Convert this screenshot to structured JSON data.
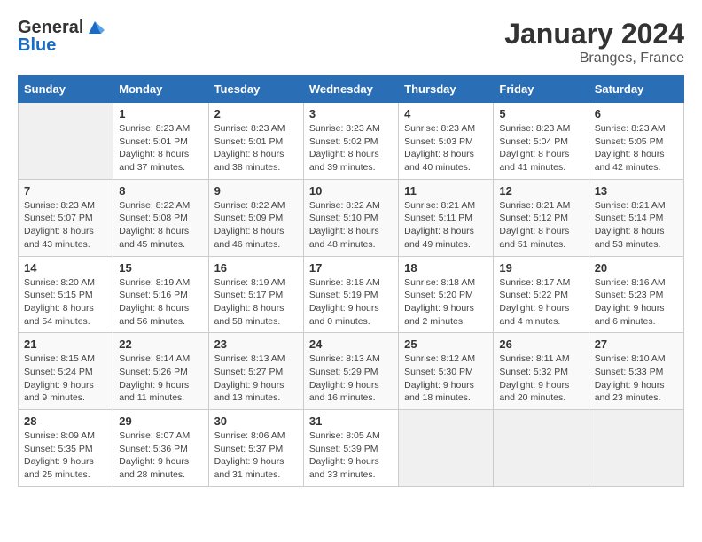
{
  "logo": {
    "line1": "General",
    "line2": "Blue"
  },
  "title": "January 2024",
  "subtitle": "Branges, France",
  "days_of_week": [
    "Sunday",
    "Monday",
    "Tuesday",
    "Wednesday",
    "Thursday",
    "Friday",
    "Saturday"
  ],
  "weeks": [
    [
      {
        "day": "",
        "info": ""
      },
      {
        "day": "1",
        "info": "Sunrise: 8:23 AM\nSunset: 5:01 PM\nDaylight: 8 hours\nand 37 minutes."
      },
      {
        "day": "2",
        "info": "Sunrise: 8:23 AM\nSunset: 5:01 PM\nDaylight: 8 hours\nand 38 minutes."
      },
      {
        "day": "3",
        "info": "Sunrise: 8:23 AM\nSunset: 5:02 PM\nDaylight: 8 hours\nand 39 minutes."
      },
      {
        "day": "4",
        "info": "Sunrise: 8:23 AM\nSunset: 5:03 PM\nDaylight: 8 hours\nand 40 minutes."
      },
      {
        "day": "5",
        "info": "Sunrise: 8:23 AM\nSunset: 5:04 PM\nDaylight: 8 hours\nand 41 minutes."
      },
      {
        "day": "6",
        "info": "Sunrise: 8:23 AM\nSunset: 5:05 PM\nDaylight: 8 hours\nand 42 minutes."
      }
    ],
    [
      {
        "day": "7",
        "info": "Sunrise: 8:23 AM\nSunset: 5:07 PM\nDaylight: 8 hours\nand 43 minutes."
      },
      {
        "day": "8",
        "info": "Sunrise: 8:22 AM\nSunset: 5:08 PM\nDaylight: 8 hours\nand 45 minutes."
      },
      {
        "day": "9",
        "info": "Sunrise: 8:22 AM\nSunset: 5:09 PM\nDaylight: 8 hours\nand 46 minutes."
      },
      {
        "day": "10",
        "info": "Sunrise: 8:22 AM\nSunset: 5:10 PM\nDaylight: 8 hours\nand 48 minutes."
      },
      {
        "day": "11",
        "info": "Sunrise: 8:21 AM\nSunset: 5:11 PM\nDaylight: 8 hours\nand 49 minutes."
      },
      {
        "day": "12",
        "info": "Sunrise: 8:21 AM\nSunset: 5:12 PM\nDaylight: 8 hours\nand 51 minutes."
      },
      {
        "day": "13",
        "info": "Sunrise: 8:21 AM\nSunset: 5:14 PM\nDaylight: 8 hours\nand 53 minutes."
      }
    ],
    [
      {
        "day": "14",
        "info": "Sunrise: 8:20 AM\nSunset: 5:15 PM\nDaylight: 8 hours\nand 54 minutes."
      },
      {
        "day": "15",
        "info": "Sunrise: 8:19 AM\nSunset: 5:16 PM\nDaylight: 8 hours\nand 56 minutes."
      },
      {
        "day": "16",
        "info": "Sunrise: 8:19 AM\nSunset: 5:17 PM\nDaylight: 8 hours\nand 58 minutes."
      },
      {
        "day": "17",
        "info": "Sunrise: 8:18 AM\nSunset: 5:19 PM\nDaylight: 9 hours\nand 0 minutes."
      },
      {
        "day": "18",
        "info": "Sunrise: 8:18 AM\nSunset: 5:20 PM\nDaylight: 9 hours\nand 2 minutes."
      },
      {
        "day": "19",
        "info": "Sunrise: 8:17 AM\nSunset: 5:22 PM\nDaylight: 9 hours\nand 4 minutes."
      },
      {
        "day": "20",
        "info": "Sunrise: 8:16 AM\nSunset: 5:23 PM\nDaylight: 9 hours\nand 6 minutes."
      }
    ],
    [
      {
        "day": "21",
        "info": "Sunrise: 8:15 AM\nSunset: 5:24 PM\nDaylight: 9 hours\nand 9 minutes."
      },
      {
        "day": "22",
        "info": "Sunrise: 8:14 AM\nSunset: 5:26 PM\nDaylight: 9 hours\nand 11 minutes."
      },
      {
        "day": "23",
        "info": "Sunrise: 8:13 AM\nSunset: 5:27 PM\nDaylight: 9 hours\nand 13 minutes."
      },
      {
        "day": "24",
        "info": "Sunrise: 8:13 AM\nSunset: 5:29 PM\nDaylight: 9 hours\nand 16 minutes."
      },
      {
        "day": "25",
        "info": "Sunrise: 8:12 AM\nSunset: 5:30 PM\nDaylight: 9 hours\nand 18 minutes."
      },
      {
        "day": "26",
        "info": "Sunrise: 8:11 AM\nSunset: 5:32 PM\nDaylight: 9 hours\nand 20 minutes."
      },
      {
        "day": "27",
        "info": "Sunrise: 8:10 AM\nSunset: 5:33 PM\nDaylight: 9 hours\nand 23 minutes."
      }
    ],
    [
      {
        "day": "28",
        "info": "Sunrise: 8:09 AM\nSunset: 5:35 PM\nDaylight: 9 hours\nand 25 minutes."
      },
      {
        "day": "29",
        "info": "Sunrise: 8:07 AM\nSunset: 5:36 PM\nDaylight: 9 hours\nand 28 minutes."
      },
      {
        "day": "30",
        "info": "Sunrise: 8:06 AM\nSunset: 5:37 PM\nDaylight: 9 hours\nand 31 minutes."
      },
      {
        "day": "31",
        "info": "Sunrise: 8:05 AM\nSunset: 5:39 PM\nDaylight: 9 hours\nand 33 minutes."
      },
      {
        "day": "",
        "info": ""
      },
      {
        "day": "",
        "info": ""
      },
      {
        "day": "",
        "info": ""
      }
    ]
  ]
}
